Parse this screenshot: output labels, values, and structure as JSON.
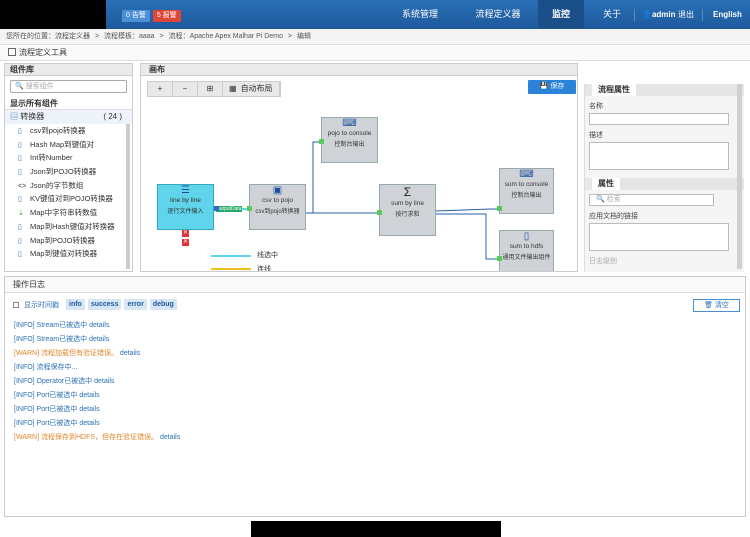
{
  "header": {
    "alerts": [
      {
        "label": "0 告警",
        "color": "#4d8fd6"
      },
      {
        "label": "5 报警",
        "color": "#e0453a"
      }
    ],
    "nav": [
      {
        "label": "系统管理",
        "active": false
      },
      {
        "label": "流程定义器",
        "active": false
      },
      {
        "label": "监控",
        "active": true
      },
      {
        "label": "关于",
        "active": false
      }
    ],
    "user": "admin",
    "logout": "退出",
    "language": "English"
  },
  "breadcrumb": [
    "您所在的位置：流程定义器",
    ">",
    "流程模板：aaaa",
    ">",
    "流程：Apache Apex Malhar Pi Demo",
    ">",
    "编辑"
  ],
  "section_title": "流程定义工具",
  "library": {
    "title": "组件库",
    "search_placeholder": "搜索组件",
    "show_all": "显示所有组件",
    "group": {
      "label": "转换器",
      "count": "( 24 )"
    },
    "items": [
      {
        "label": "csv到pojo转换器",
        "icon": "file-icon"
      },
      {
        "label": "Hash Map到键值对",
        "icon": "file-icon"
      },
      {
        "label": "Int转Number",
        "icon": "file-icon"
      },
      {
        "label": "Json到POJO转换器",
        "icon": "file-icon"
      },
      {
        "label": "Json的字节数组",
        "icon": "code-icon"
      },
      {
        "label": "KV键值对到POJO转换器",
        "icon": "file-icon"
      },
      {
        "label": "Map中字符串转数值",
        "icon": "sort-icon"
      },
      {
        "label": "Map到Hash键值对转换器",
        "icon": "file-icon"
      },
      {
        "label": "Map到POJO转换器",
        "icon": "file-icon"
      },
      {
        "label": "Map到键值对转换器",
        "icon": "file-icon"
      }
    ]
  },
  "canvas": {
    "title": "画布",
    "toolbar": {
      "zoom_in": "+",
      "zoom_out": "−",
      "fit": "⊞",
      "auto_layout": "自动布局"
    },
    "save_label": "保存",
    "nodes": {
      "line_by_line": {
        "title": "line by line",
        "subtitle": "逐行文件输入"
      },
      "csv_to_pojo": {
        "title": "csv to pojo",
        "subtitle": "csv到pojo转换器"
      },
      "pojo_to_console": {
        "title": "pojo to console",
        "subtitle": "控制台输出"
      },
      "sum_by_line": {
        "title": "sum by line",
        "subtitle": "按行求和"
      },
      "sum_to_console": {
        "title": "sum to console",
        "subtitle": "控制台输出"
      },
      "sum_to_hdfs": {
        "title": "sum to hdfs",
        "subtitle": "通用文件输出组件"
      }
    },
    "edge_label": "outputData",
    "legend": [
      {
        "label": "线选中",
        "color": "#5fd4ea"
      },
      {
        "label": "连线",
        "color": "#f0c020"
      }
    ]
  },
  "properties": {
    "title": "流程属性",
    "name_label": "名称",
    "desc_label": "描述",
    "attr_title": "属性",
    "search_placeholder": "检索",
    "doc_link_label": "应用文档的链接",
    "cut_text": "日志级别"
  },
  "log": {
    "title": "操作日志",
    "show_time": "显示时间戳",
    "filters": [
      "info",
      "success",
      "error",
      "debug"
    ],
    "clear_label": "清空",
    "lines": [
      {
        "level": "info",
        "text": "[INFO] Stream已被选中",
        "detail": "details"
      },
      {
        "level": "info",
        "text": "[INFO] Stream已被选中",
        "detail": "details"
      },
      {
        "level": "warn",
        "text": "[WARN] 流程加载但有验证错误。",
        "detail": "details"
      },
      {
        "level": "info",
        "text": "[INFO] 流程保存中...",
        "detail": ""
      },
      {
        "level": "info",
        "text": "[INFO] Operator已被选中",
        "detail": "details"
      },
      {
        "level": "info",
        "text": "[INFO] Port已被选中",
        "detail": "details"
      },
      {
        "level": "info",
        "text": "[INFO] Port已被选中",
        "detail": "details"
      },
      {
        "level": "info",
        "text": "[INFO] Port已被选中",
        "detail": "details"
      },
      {
        "level": "warn",
        "text": "[WARN] 流程保存到HDFS，但存在验证错误。",
        "detail": "details"
      }
    ]
  }
}
